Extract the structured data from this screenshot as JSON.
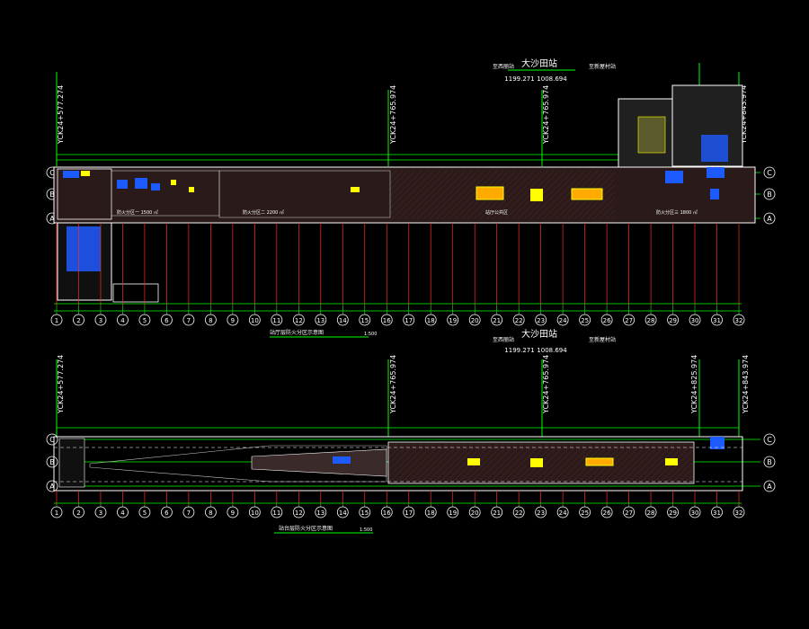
{
  "colors": {
    "background": "#000000",
    "grid": "#00ff00",
    "axis_red": "#ff2a2a",
    "wall": "#ffffff",
    "yellow": "#ffff00",
    "blue": "#1e5bff",
    "cyan": "#00ffff",
    "orange": "#ff8800",
    "magenta": "#ff00ff"
  },
  "station_title": "大沙田站",
  "station_title_2": "大沙田站",
  "chainage_labels": [
    "YCK24+577.274",
    "YCK24+765.974",
    "YCK24+825.974",
    "YCK24+843.974"
  ],
  "mileage_pair": [
    "1199.271",
    "1008.694"
  ],
  "left_note": "至西丽站",
  "right_note": "至新屋村站",
  "row_labels": [
    "C",
    "B",
    "A"
  ],
  "column_numbers": [
    "1",
    "2",
    "3",
    "4",
    "5",
    "6",
    "7",
    "8",
    "9",
    "10",
    "11",
    "12",
    "13",
    "14",
    "15",
    "16",
    "17",
    "18",
    "19",
    "20",
    "21",
    "22",
    "23",
    "24",
    "25",
    "26",
    "27",
    "28",
    "29",
    "30",
    "31",
    "32"
  ],
  "plans": [
    {
      "id": "upper",
      "caption": "站厅层防火分区示意图",
      "scale": "1:500"
    },
    {
      "id": "lower",
      "caption": "站台层防火分区示意图",
      "scale": "1:500"
    }
  ],
  "notes": {
    "fire_zone_a": "防火分区一 1500 ㎡",
    "fire_zone_b": "防火分区二 2200 ㎡",
    "fire_zone_c": "防火分区三 1800 ㎡",
    "hall": "站厅公共区"
  }
}
